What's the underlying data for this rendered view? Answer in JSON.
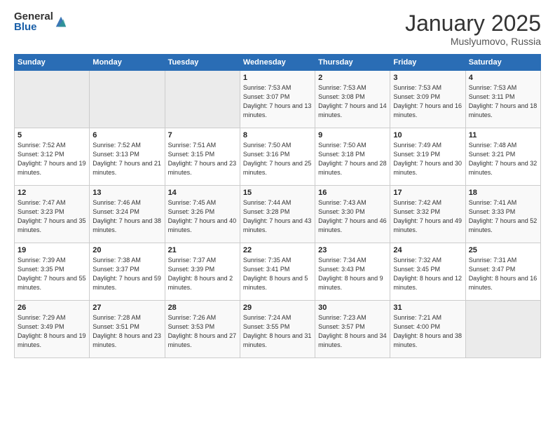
{
  "header": {
    "logo_general": "General",
    "logo_blue": "Blue",
    "month_title": "January 2025",
    "location": "Muslyumovo, Russia"
  },
  "weekdays": [
    "Sunday",
    "Monday",
    "Tuesday",
    "Wednesday",
    "Thursday",
    "Friday",
    "Saturday"
  ],
  "weeks": [
    [
      {
        "day": "",
        "sunrise": "",
        "sunset": "",
        "daylight": ""
      },
      {
        "day": "",
        "sunrise": "",
        "sunset": "",
        "daylight": ""
      },
      {
        "day": "",
        "sunrise": "",
        "sunset": "",
        "daylight": ""
      },
      {
        "day": "1",
        "sunrise": "Sunrise: 7:53 AM",
        "sunset": "Sunset: 3:07 PM",
        "daylight": "Daylight: 7 hours and 13 minutes."
      },
      {
        "day": "2",
        "sunrise": "Sunrise: 7:53 AM",
        "sunset": "Sunset: 3:08 PM",
        "daylight": "Daylight: 7 hours and 14 minutes."
      },
      {
        "day": "3",
        "sunrise": "Sunrise: 7:53 AM",
        "sunset": "Sunset: 3:09 PM",
        "daylight": "Daylight: 7 hours and 16 minutes."
      },
      {
        "day": "4",
        "sunrise": "Sunrise: 7:53 AM",
        "sunset": "Sunset: 3:11 PM",
        "daylight": "Daylight: 7 hours and 18 minutes."
      }
    ],
    [
      {
        "day": "5",
        "sunrise": "Sunrise: 7:52 AM",
        "sunset": "Sunset: 3:12 PM",
        "daylight": "Daylight: 7 hours and 19 minutes."
      },
      {
        "day": "6",
        "sunrise": "Sunrise: 7:52 AM",
        "sunset": "Sunset: 3:13 PM",
        "daylight": "Daylight: 7 hours and 21 minutes."
      },
      {
        "day": "7",
        "sunrise": "Sunrise: 7:51 AM",
        "sunset": "Sunset: 3:15 PM",
        "daylight": "Daylight: 7 hours and 23 minutes."
      },
      {
        "day": "8",
        "sunrise": "Sunrise: 7:50 AM",
        "sunset": "Sunset: 3:16 PM",
        "daylight": "Daylight: 7 hours and 25 minutes."
      },
      {
        "day": "9",
        "sunrise": "Sunrise: 7:50 AM",
        "sunset": "Sunset: 3:18 PM",
        "daylight": "Daylight: 7 hours and 28 minutes."
      },
      {
        "day": "10",
        "sunrise": "Sunrise: 7:49 AM",
        "sunset": "Sunset: 3:19 PM",
        "daylight": "Daylight: 7 hours and 30 minutes."
      },
      {
        "day": "11",
        "sunrise": "Sunrise: 7:48 AM",
        "sunset": "Sunset: 3:21 PM",
        "daylight": "Daylight: 7 hours and 32 minutes."
      }
    ],
    [
      {
        "day": "12",
        "sunrise": "Sunrise: 7:47 AM",
        "sunset": "Sunset: 3:23 PM",
        "daylight": "Daylight: 7 hours and 35 minutes."
      },
      {
        "day": "13",
        "sunrise": "Sunrise: 7:46 AM",
        "sunset": "Sunset: 3:24 PM",
        "daylight": "Daylight: 7 hours and 38 minutes."
      },
      {
        "day": "14",
        "sunrise": "Sunrise: 7:45 AM",
        "sunset": "Sunset: 3:26 PM",
        "daylight": "Daylight: 7 hours and 40 minutes."
      },
      {
        "day": "15",
        "sunrise": "Sunrise: 7:44 AM",
        "sunset": "Sunset: 3:28 PM",
        "daylight": "Daylight: 7 hours and 43 minutes."
      },
      {
        "day": "16",
        "sunrise": "Sunrise: 7:43 AM",
        "sunset": "Sunset: 3:30 PM",
        "daylight": "Daylight: 7 hours and 46 minutes."
      },
      {
        "day": "17",
        "sunrise": "Sunrise: 7:42 AM",
        "sunset": "Sunset: 3:32 PM",
        "daylight": "Daylight: 7 hours and 49 minutes."
      },
      {
        "day": "18",
        "sunrise": "Sunrise: 7:41 AM",
        "sunset": "Sunset: 3:33 PM",
        "daylight": "Daylight: 7 hours and 52 minutes."
      }
    ],
    [
      {
        "day": "19",
        "sunrise": "Sunrise: 7:39 AM",
        "sunset": "Sunset: 3:35 PM",
        "daylight": "Daylight: 7 hours and 55 minutes."
      },
      {
        "day": "20",
        "sunrise": "Sunrise: 7:38 AM",
        "sunset": "Sunset: 3:37 PM",
        "daylight": "Daylight: 7 hours and 59 minutes."
      },
      {
        "day": "21",
        "sunrise": "Sunrise: 7:37 AM",
        "sunset": "Sunset: 3:39 PM",
        "daylight": "Daylight: 8 hours and 2 minutes."
      },
      {
        "day": "22",
        "sunrise": "Sunrise: 7:35 AM",
        "sunset": "Sunset: 3:41 PM",
        "daylight": "Daylight: 8 hours and 5 minutes."
      },
      {
        "day": "23",
        "sunrise": "Sunrise: 7:34 AM",
        "sunset": "Sunset: 3:43 PM",
        "daylight": "Daylight: 8 hours and 9 minutes."
      },
      {
        "day": "24",
        "sunrise": "Sunrise: 7:32 AM",
        "sunset": "Sunset: 3:45 PM",
        "daylight": "Daylight: 8 hours and 12 minutes."
      },
      {
        "day": "25",
        "sunrise": "Sunrise: 7:31 AM",
        "sunset": "Sunset: 3:47 PM",
        "daylight": "Daylight: 8 hours and 16 minutes."
      }
    ],
    [
      {
        "day": "26",
        "sunrise": "Sunrise: 7:29 AM",
        "sunset": "Sunset: 3:49 PM",
        "daylight": "Daylight: 8 hours and 19 minutes."
      },
      {
        "day": "27",
        "sunrise": "Sunrise: 7:28 AM",
        "sunset": "Sunset: 3:51 PM",
        "daylight": "Daylight: 8 hours and 23 minutes."
      },
      {
        "day": "28",
        "sunrise": "Sunrise: 7:26 AM",
        "sunset": "Sunset: 3:53 PM",
        "daylight": "Daylight: 8 hours and 27 minutes."
      },
      {
        "day": "29",
        "sunrise": "Sunrise: 7:24 AM",
        "sunset": "Sunset: 3:55 PM",
        "daylight": "Daylight: 8 hours and 31 minutes."
      },
      {
        "day": "30",
        "sunrise": "Sunrise: 7:23 AM",
        "sunset": "Sunset: 3:57 PM",
        "daylight": "Daylight: 8 hours and 34 minutes."
      },
      {
        "day": "31",
        "sunrise": "Sunrise: 7:21 AM",
        "sunset": "Sunset: 4:00 PM",
        "daylight": "Daylight: 8 hours and 38 minutes."
      },
      {
        "day": "",
        "sunrise": "",
        "sunset": "",
        "daylight": ""
      }
    ]
  ]
}
